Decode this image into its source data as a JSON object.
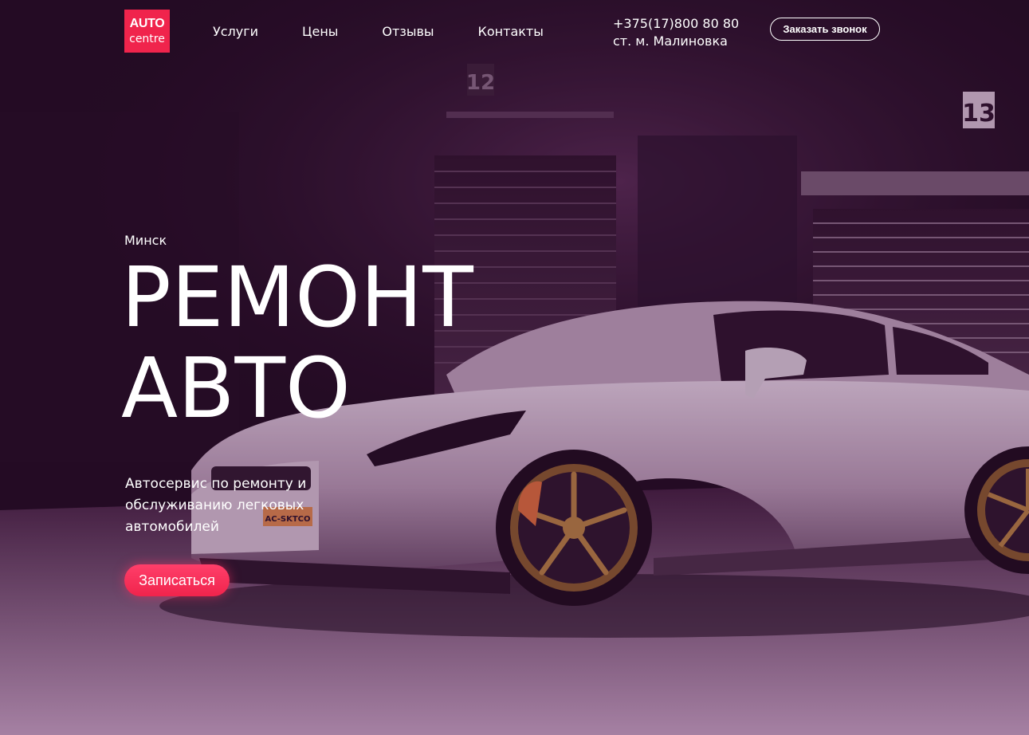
{
  "colors": {
    "accent": "#f0244c",
    "overlay": "#3a0a3a",
    "text": "#ffffff"
  },
  "header": {
    "logo": {
      "top": "AUTO",
      "bottom": "centre"
    },
    "nav": [
      "Услуги",
      "Цены",
      "Отзывы",
      "Контакты"
    ],
    "phone": "+375(17)800 80 80",
    "address": "ст. м. Малиновка",
    "callback_label": "Заказать звонок"
  },
  "hero": {
    "city": "Минск",
    "title_line1": "РЕМОНТ",
    "title_line2": "АВТО",
    "subtitle": "Автосервис по ремонту и обслуживанию легковых автомобилей",
    "cta_label": "Записаться",
    "garage_numbers": [
      "12",
      "13"
    ],
    "plate_text": "AC-SKTCO"
  }
}
